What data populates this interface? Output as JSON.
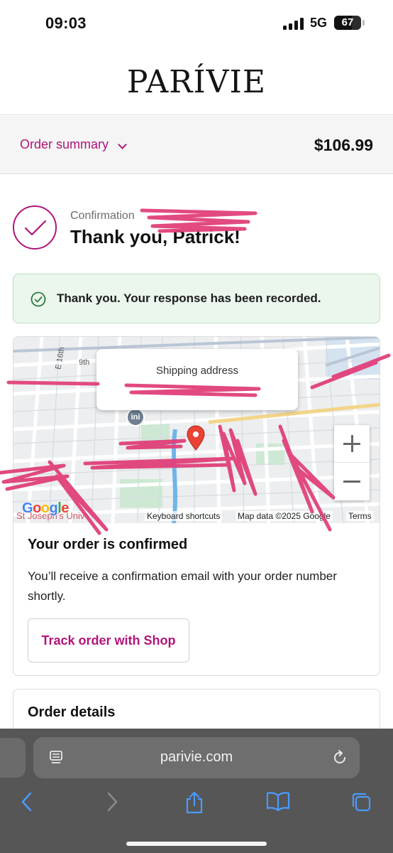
{
  "status_bar": {
    "time": "09:03",
    "network": "5G",
    "battery": "67",
    "battery_level": 0.67
  },
  "brand": {
    "logo_text": "PARÍVIE"
  },
  "order_summary": {
    "toggle_label": "Order summary",
    "total": "$106.99"
  },
  "confirmation": {
    "label": "Confirmation",
    "title": "Thank you, Patrick!"
  },
  "banner": {
    "message": "Thank you. Your response has been recorded."
  },
  "map": {
    "popup_title": "Shipping address",
    "transit_label": "ini",
    "labels": {
      "street_16th": "E 16th",
      "street_9th": "9th",
      "place_univ": "St Joseph's Univ"
    },
    "google_logo": "Google",
    "keyboard_shortcuts": "Keyboard shortcuts",
    "map_data": "Map data ©2025 Google",
    "terms": "Terms"
  },
  "order_confirmed": {
    "title": "Your order is confirmed",
    "body": "You’ll receive a confirmation email with your order number shortly.",
    "track_button": "Track order with Shop"
  },
  "order_details": {
    "title": "Order details"
  },
  "browser": {
    "url": "parivie.com"
  },
  "colors": {
    "accent": "#b0157a",
    "success_bg": "#ebf6ed",
    "redaction": "#e0407a"
  }
}
